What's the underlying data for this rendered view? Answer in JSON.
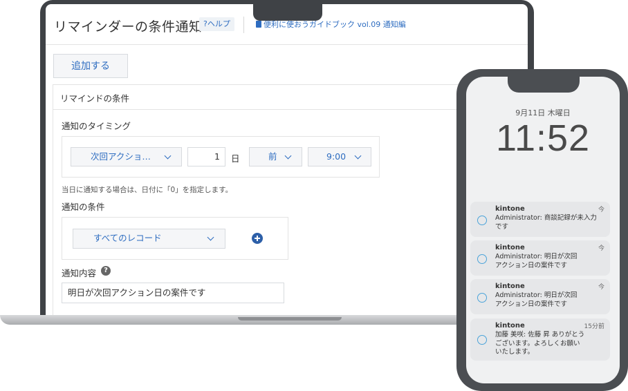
{
  "laptop": {
    "title": "リマインダーの条件通知",
    "help_label": "?ヘルプ",
    "guide_link": "便利に使おうガイドブック vol.09 通知編",
    "add_button": "追加する",
    "section_heading": "リマインドの条件",
    "timing": {
      "label": "通知のタイミング",
      "field_select": "次回アクショ…",
      "offset_value": "1",
      "unit": "日",
      "direction_select": "前",
      "time_select": "9:00"
    },
    "hint": "当日に通知する場合は、日付に「0」を指定します。",
    "condition": {
      "label": "通知の条件",
      "record_select": "すべてのレコード"
    },
    "content": {
      "label": "通知内容",
      "value": "明日が次回アクション日の案件です"
    }
  },
  "phone": {
    "date": "9月11日 木曜日",
    "time": "11:52",
    "notifications": [
      {
        "app": "kintone",
        "time": "今",
        "line1": "Administrator: 商談記録が未入力",
        "line2": "です",
        "line3": ""
      },
      {
        "app": "kintone",
        "time": "今",
        "line1": "Administrator: 明日が次回",
        "line2": "アクション日の案件です",
        "line3": ""
      },
      {
        "app": "kintone",
        "time": "今",
        "line1": "Administrator: 明日が次回",
        "line2": "アクション日の案件です",
        "line3": ""
      },
      {
        "app": "kintone",
        "time": "15分前",
        "line1": "加藤 美咲: 佐藤 昇 ありがとう",
        "line2": "ございます。よろしくお願い",
        "line3": "いたします。"
      }
    ]
  },
  "colors": {
    "accent": "#2d6cc0",
    "device_frame": "#3f4246",
    "icon_blue": "#4aa3d9"
  }
}
